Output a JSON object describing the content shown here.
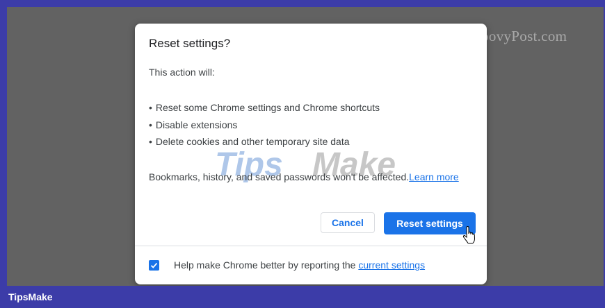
{
  "watermark_site": "groovyPost.com",
  "watermark_overlay": {
    "part1": "Tips",
    "part2": "Make"
  },
  "dialog": {
    "title": "Reset settings?",
    "intro": "This action will:",
    "bullets": [
      "Reset some Chrome settings and Chrome shortcuts",
      "Disable extensions",
      "Delete cookies and other temporary site data"
    ],
    "note": "Bookmarks, history, and saved passwords won't be affected.",
    "learn_more": "Learn more",
    "cancel_label": "Cancel",
    "reset_label": "Reset settings",
    "checkbox_checked": true,
    "help_text": "Help make Chrome better by reporting the",
    "help_link": "current settings"
  },
  "footer": {
    "brand": "TipsMake"
  },
  "colors": {
    "accent": "#1a73e8",
    "backdrop": "#626262",
    "frame": "#3c3ca8"
  },
  "icons": [
    "hand-pointer-icon",
    "checkmark-icon"
  ]
}
